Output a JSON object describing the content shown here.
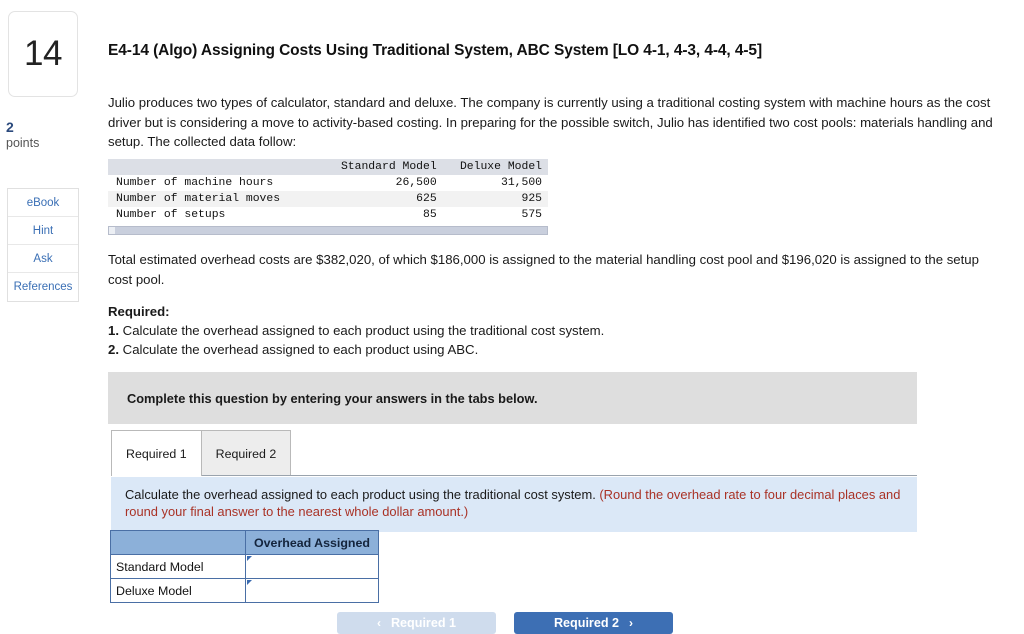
{
  "question": {
    "number": "14",
    "points_value": "2",
    "points_label": "points"
  },
  "rail": {
    "buttons": [
      {
        "label": "eBook",
        "name": "ebook"
      },
      {
        "label": "Hint",
        "name": "hint"
      },
      {
        "label": "Ask",
        "name": "ask"
      },
      {
        "label": "References",
        "name": "references"
      }
    ]
  },
  "title": "E4-14 (Algo) Assigning Costs Using Traditional System, ABC System [LO 4-1, 4-3, 4-4, 4-5]",
  "intro": "Julio produces two types of calculator, standard and deluxe. The company is currently using a traditional costing system with machine hours as the cost driver but is considering a move to activity-based costing. In preparing for the possible switch, Julio has identified two cost pools: materials handling and setup. The collected data follow:",
  "data_table": {
    "columns": [
      "",
      "Standard Model",
      "Deluxe Model"
    ],
    "rows": [
      {
        "label": "Number of machine hours",
        "standard": "26,500",
        "deluxe": "31,500"
      },
      {
        "label": "Number of material moves",
        "standard": "625",
        "deluxe": "925"
      },
      {
        "label": "Number of setups",
        "standard": "85",
        "deluxe": "575"
      }
    ]
  },
  "overhead_paragraph": "Total estimated overhead costs are $382,020, of which $186,000 is assigned to the material handling cost pool and $196,020 is assigned to the setup cost pool.",
  "required": {
    "heading": "Required:",
    "items": [
      {
        "num": "1.",
        "text": "Calculate the overhead assigned to each product using the traditional cost system."
      },
      {
        "num": "2.",
        "text": "Calculate the overhead assigned to each product using ABC."
      }
    ]
  },
  "grey_band_text": "Complete this question by entering your answers in the tabs below.",
  "tabs": [
    {
      "label": "Required 1",
      "active": true
    },
    {
      "label": "Required 2",
      "active": false
    }
  ],
  "instruction": {
    "main": "Calculate the overhead assigned to each product using the traditional cost system.",
    "note": "(Round the overhead rate to four decimal places and round your final answer to the nearest whole dollar amount.)"
  },
  "answer_table": {
    "corner": "",
    "column_header": "Overhead Assigned",
    "rows": [
      {
        "label": "Standard Model",
        "value": ""
      },
      {
        "label": "Deluxe Model",
        "value": ""
      }
    ]
  },
  "nav": {
    "prev_label": "Required 1",
    "prev_chevron": "‹",
    "next_label": "Required 2",
    "next_chevron": "›"
  },
  "colors": {
    "accent_blue": "#3d6fb4",
    "table_header_blue": "#8cb0d9",
    "instruction_blue": "#dbe8f7",
    "note_red": "#a93226",
    "grey_band": "#dedede"
  }
}
